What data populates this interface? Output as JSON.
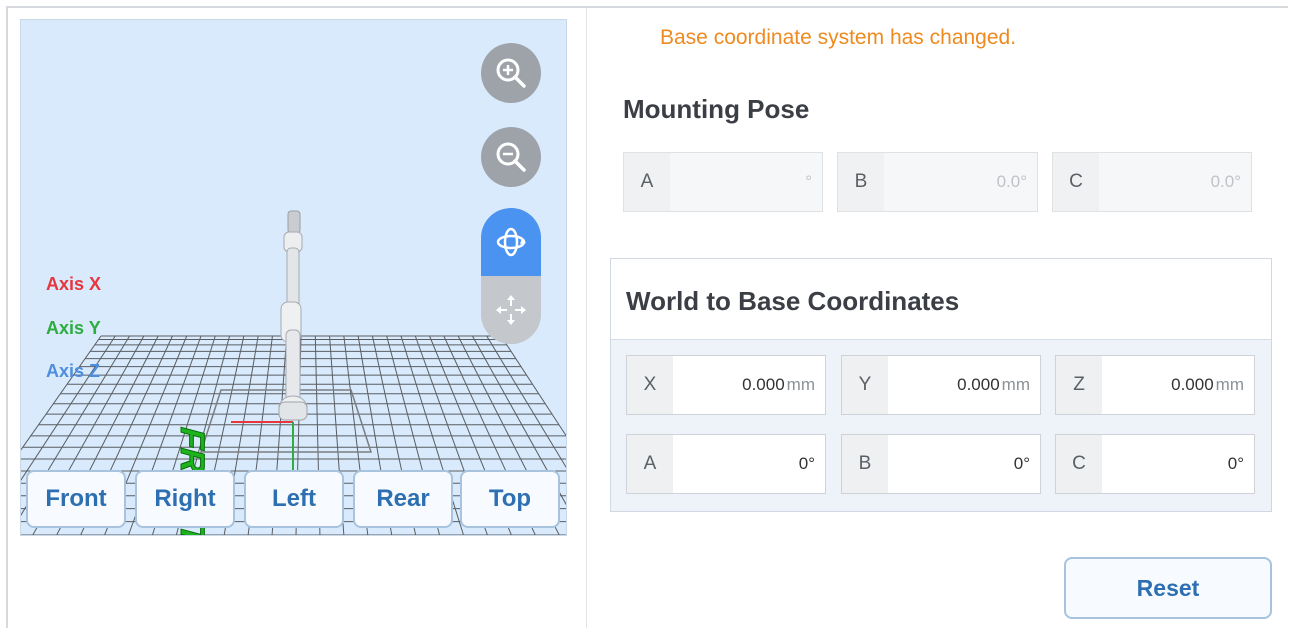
{
  "viewport": {
    "axis_labels": {
      "x": "Axis X",
      "y": "Axis Y",
      "z": "Axis Z"
    },
    "floor_marker": "FRONT",
    "controls": {
      "zoom_in_icon": "zoom-in-icon",
      "zoom_out_icon": "zoom-out-icon",
      "rotate_icon": "rotate-icon",
      "pan_icon": "pan-icon",
      "active_mode": "rotate"
    },
    "view_buttons": [
      "Front",
      "Right",
      "Left",
      "Rear",
      "Top"
    ]
  },
  "warning_text": "Base coordinate system has changed.",
  "mounting_pose": {
    "title": "Mounting Pose",
    "fields": [
      {
        "label": "A",
        "value": "°"
      },
      {
        "label": "B",
        "value": "0.0°"
      },
      {
        "label": "C",
        "value": "0.0°"
      }
    ]
  },
  "world_to_base": {
    "title": "World to Base Coordinates",
    "position_fields": [
      {
        "label": "X",
        "value": "0.000",
        "unit": "mm"
      },
      {
        "label": "Y",
        "value": "0.000",
        "unit": "mm"
      },
      {
        "label": "Z",
        "value": "0.000",
        "unit": "mm"
      }
    ],
    "rotation_fields": [
      {
        "label": "A",
        "value": "0°"
      },
      {
        "label": "B",
        "value": "0°"
      },
      {
        "label": "C",
        "value": "0°"
      }
    ]
  },
  "reset_label": "Reset",
  "colors": {
    "accent": "#2d6fb0",
    "warning": "#ee8a1f",
    "axis_x": "#e8363f",
    "axis_y": "#2dad3f",
    "axis_z": "#4d8ee0",
    "active_control": "#4a93f0"
  }
}
